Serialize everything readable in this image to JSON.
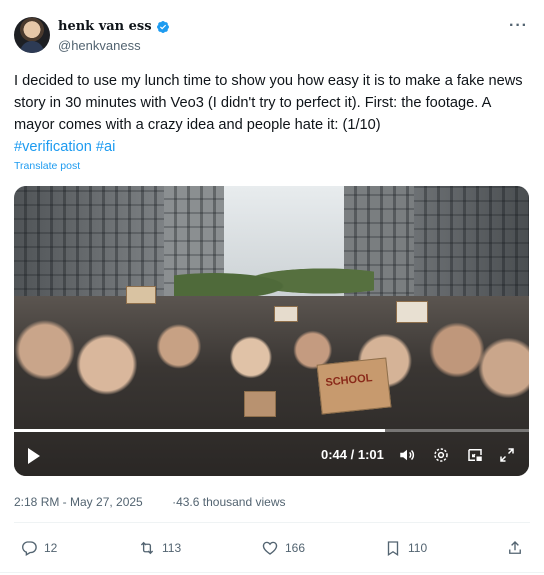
{
  "author": {
    "display_name": "henk van ess",
    "handle": "@henkvaness"
  },
  "tweet": {
    "text": "I decided to use my lunch time to show you how easy it is to make a fake news story in 30  minutes with Veo3 (I didn't try to perfect it).  First: the footage. A mayor comes with a crazy idea and people hate it: (1/10)",
    "hashtags": "#verification #ai",
    "translate_label": "Translate post"
  },
  "video": {
    "sign_text": "SCHOOL",
    "time_display": "0:44 / 1:01",
    "progress_fraction": 0.72
  },
  "meta": {
    "timestamp": "2:18 RM - May 27, 2025",
    "separator": "·",
    "views": "43.6 thousand views"
  },
  "actions": {
    "replies": "12",
    "reposts": "113",
    "likes": "166",
    "bookmarks": "110"
  },
  "colors": {
    "accent": "#1d9bf0",
    "secondary_text": "#536471",
    "primary_text": "#0f1419"
  }
}
